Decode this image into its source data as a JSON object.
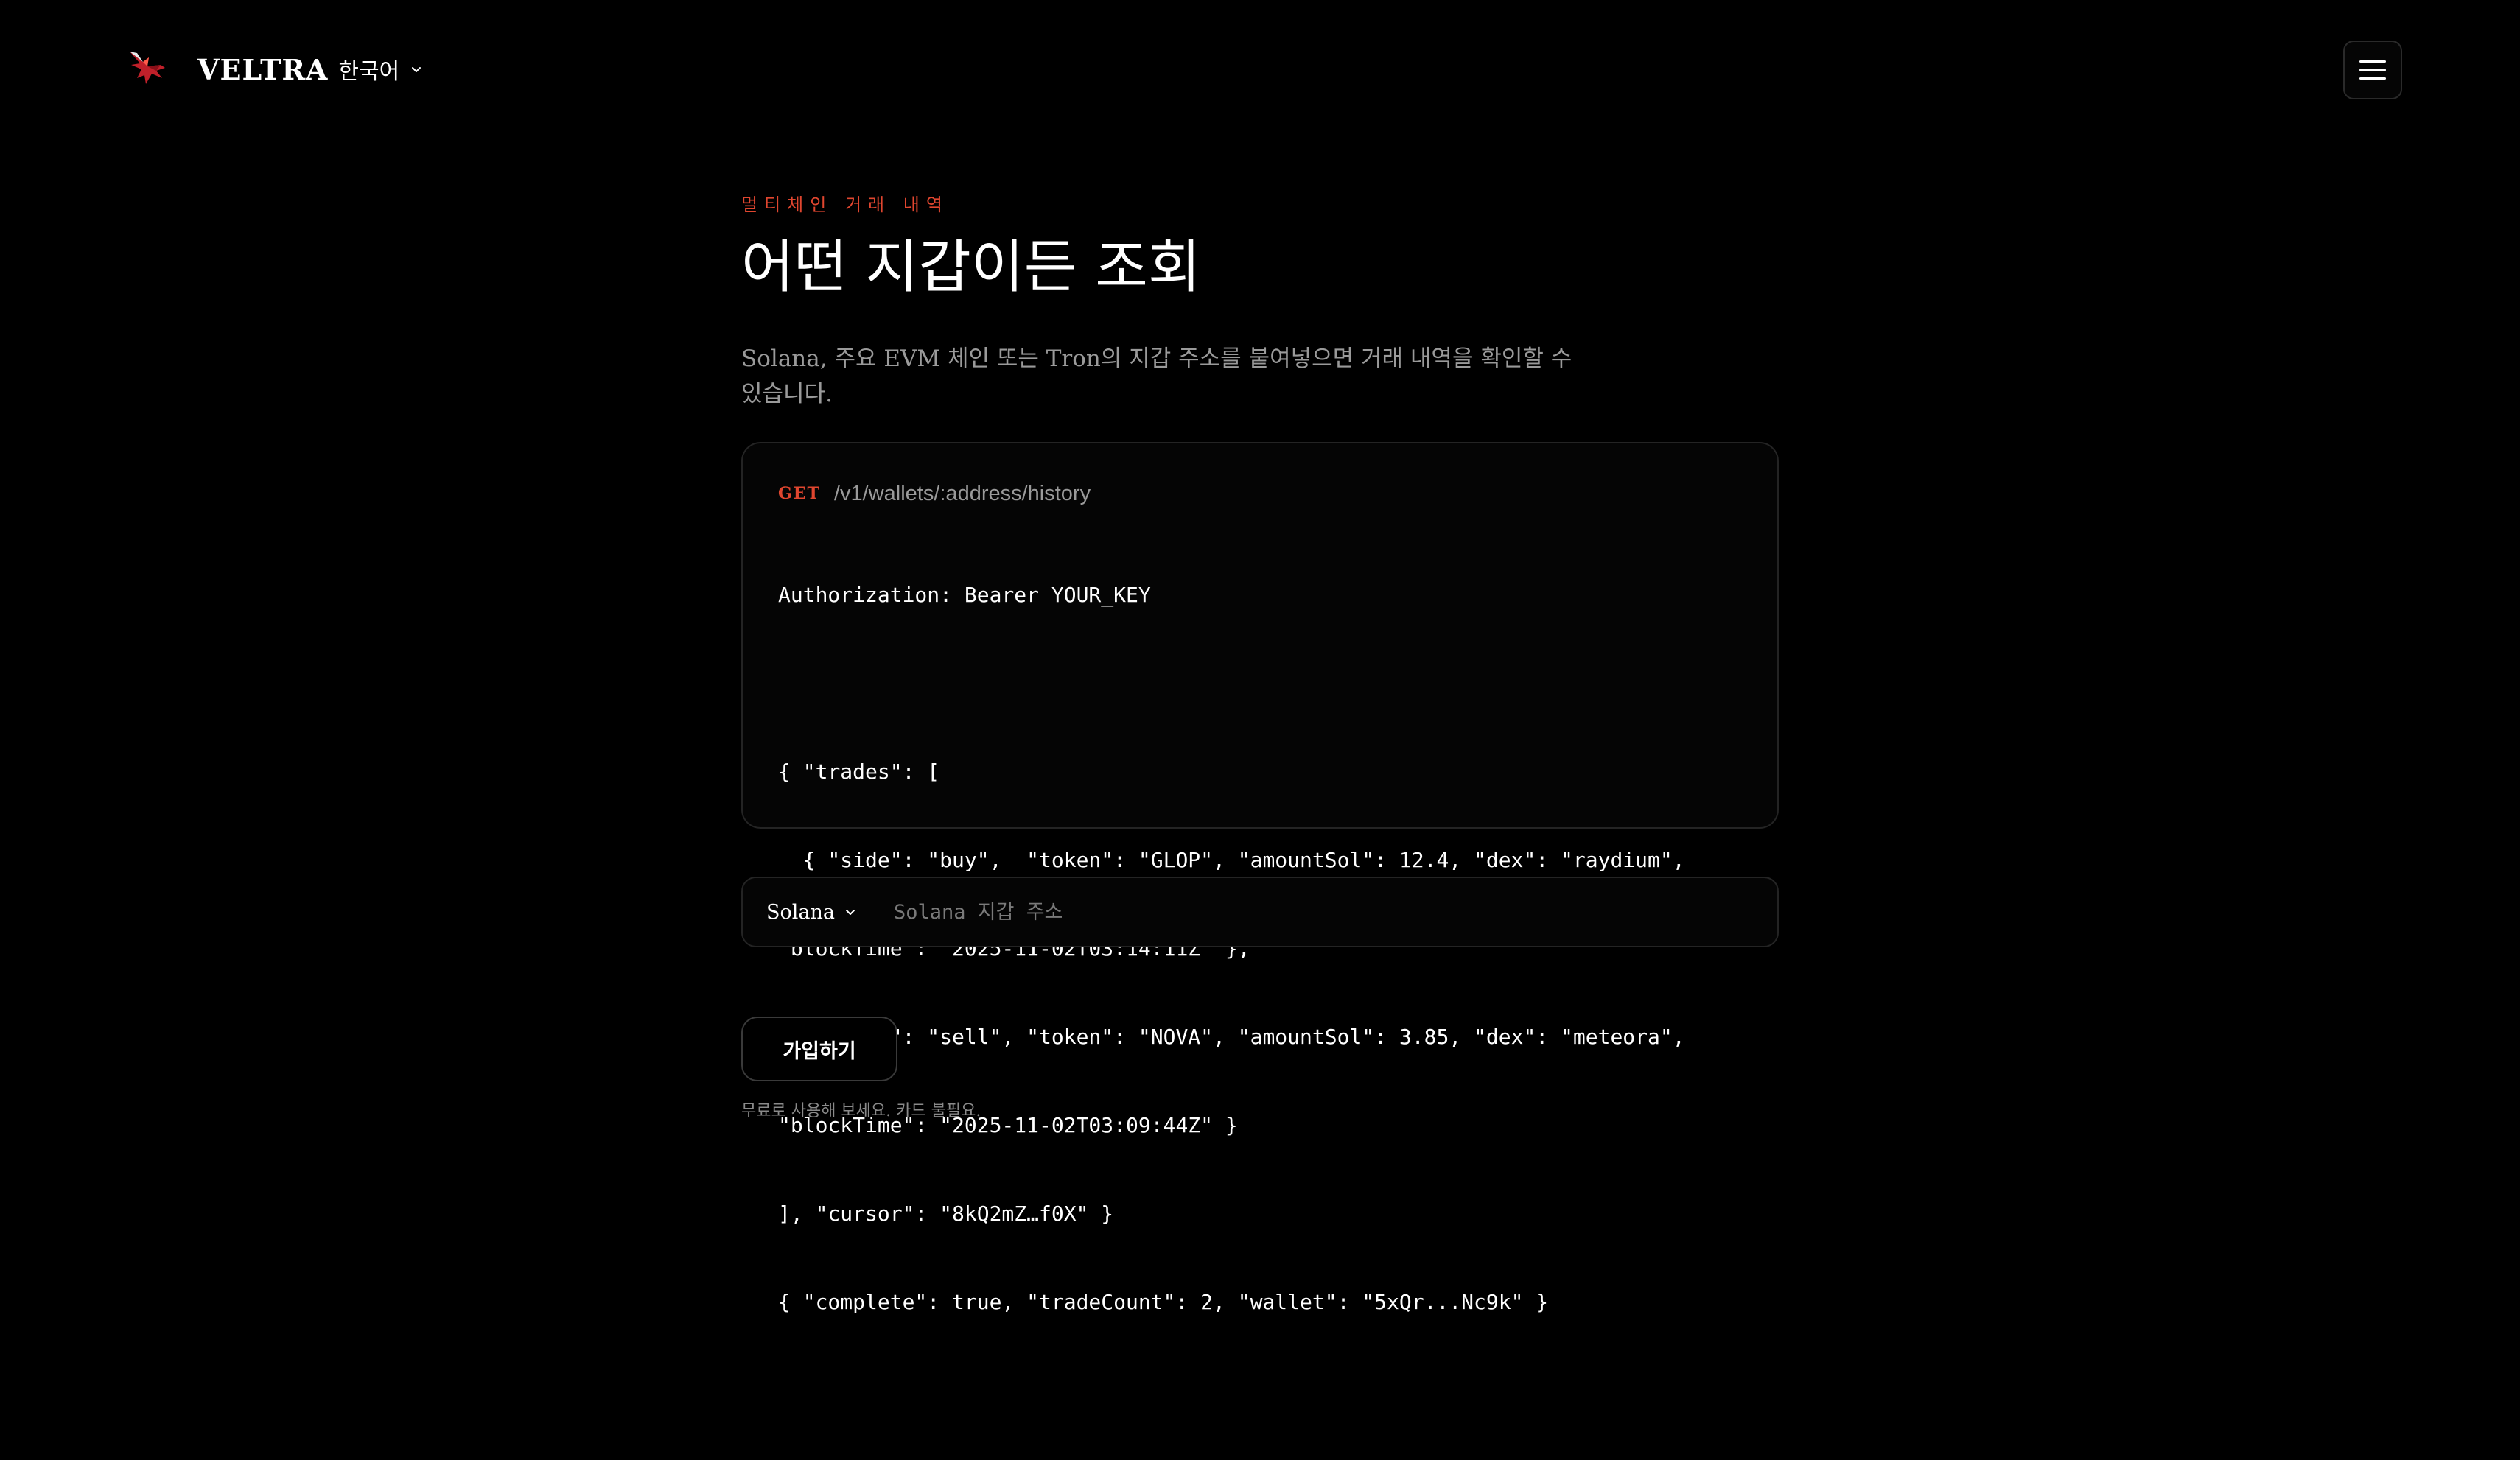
{
  "header": {
    "brand_name": "VELTRA",
    "language_label": "한국어",
    "logo_icon": "bird-logo-icon",
    "menu_icon": "hamburger-menu-icon"
  },
  "hero": {
    "eyebrow": "멀티체인 거래 내역",
    "title": "어떤 지갑이든 조회",
    "subtitle": "Solana, 주요 EVM 체인 또는 Tron의 지갑 주소를 붙여넣으면 거래 내역을 확인할 수 있습니다."
  },
  "api_example": {
    "method": "GET",
    "path": "/v1/wallets/:address/history",
    "code_lines": [
      "Authorization: Bearer YOUR_KEY",
      "",
      "{ \"trades\": [",
      "  { \"side\": \"buy\",  \"token\": \"GLOP\", \"amountSol\": 12.4, \"dex\": \"raydium\",",
      "\"blockTime\": \"2025-11-02T03:14:11Z\" },",
      "  { \"side\": \"sell\", \"token\": \"NOVA\", \"amountSol\": 3.85, \"dex\": \"meteora\",",
      "\"blockTime\": \"2025-11-02T03:09:44Z\" }",
      "], \"cursor\": \"8kQ2mZ…f0X\" }",
      "{ \"complete\": true, \"tradeCount\": 2, \"wallet\": \"5xQr...Nc9k\" }"
    ]
  },
  "lookup": {
    "chain_selected": "Solana",
    "address_value": "",
    "address_placeholder": "Solana 지갑 주소"
  },
  "cta": {
    "signup_label": "가입하기",
    "note": "무료로 사용해 보세요. 카드 불필요."
  },
  "colors": {
    "background": "#000000",
    "accent": "#e0462f",
    "muted_text": "#9a9a9a",
    "border": "#242424"
  }
}
